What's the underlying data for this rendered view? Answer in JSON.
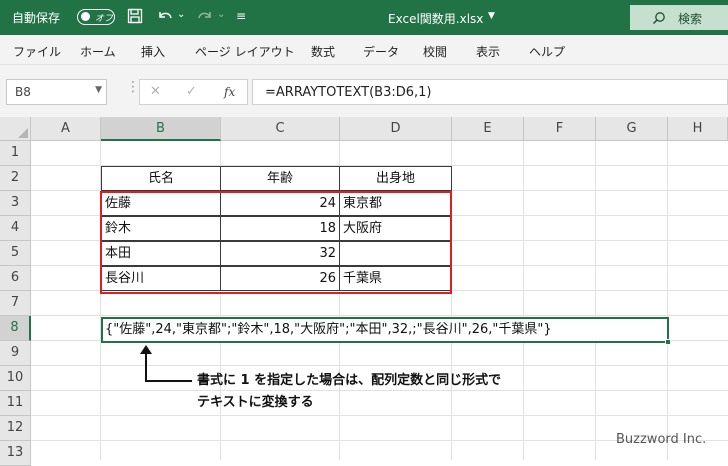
{
  "titlebar": {
    "autosave_label": "自動保存",
    "autosave_state": "オフ",
    "filename": "Excel関数用.xlsx",
    "search_label": "検索"
  },
  "ribbon": {
    "tabs": [
      "ファイル",
      "ホーム",
      "挿入",
      "ページ レイアウト",
      "数式",
      "データ",
      "校閲",
      "表示",
      "ヘルプ"
    ]
  },
  "formula_bar": {
    "name_box": "B8",
    "fx_label": "fx",
    "formula": "=ARRAYTOTEXT(B3:D6,1)"
  },
  "columns": [
    "A",
    "B",
    "C",
    "D",
    "E",
    "F",
    "G",
    "H"
  ],
  "rows": [
    "1",
    "2",
    "3",
    "4",
    "5",
    "6",
    "7",
    "8",
    "9",
    "10",
    "11",
    "12",
    "13"
  ],
  "table": {
    "headers": [
      "氏名",
      "年齢",
      "出身地"
    ],
    "rows": [
      [
        "佐藤",
        "24",
        "東京都"
      ],
      [
        "鈴木",
        "18",
        "大阪府"
      ],
      [
        "本田",
        "32",
        ""
      ],
      [
        "長谷川",
        "26",
        "千葉県"
      ]
    ]
  },
  "result_cell": "{\"佐藤\",24,\"東京都\";\"鈴木\",18,\"大阪府\";\"本田\",32,;\"長谷川\",26,\"千葉県\"}",
  "annotation": {
    "line1": "書式に 1 を指定した場合は、配列定数と同じ形式で",
    "line2": "テキストに変換する"
  },
  "brand": "Buzzword Inc.",
  "colors": {
    "excel_green": "#217346",
    "highlight_red": "#e01e1e"
  }
}
